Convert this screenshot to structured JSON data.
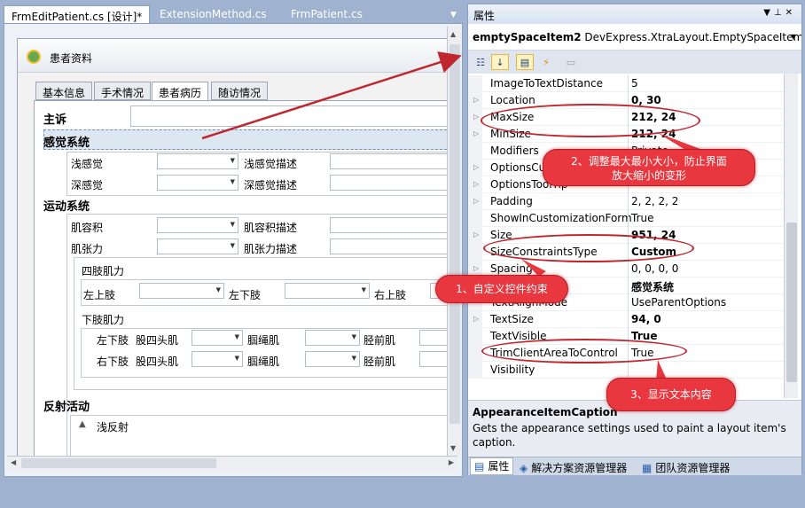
{
  "doc_tabs": [
    {
      "label": "FrmEditPatient.cs [设计]*",
      "active": true
    },
    {
      "label": "ExtensionMethod.cs",
      "active": false
    },
    {
      "label": "FrmPatient.cs",
      "active": false
    }
  ],
  "form": {
    "title": "患者资料",
    "tabs": [
      "基本信息",
      "手术情况",
      "患者病历",
      "随访情况"
    ],
    "active_tab": "患者病历",
    "chief_complaint": "主诉",
    "sensory": {
      "title": "感觉系统",
      "shallow": "浅感觉",
      "shallow_desc": "浅感觉描述",
      "deep": "深感觉",
      "deep_desc": "深感觉描述"
    },
    "motor": {
      "title": "运动系统",
      "volume": "肌容积",
      "volume_desc": "肌容积描述",
      "tension": "肌张力",
      "tension_desc": "肌张力描述",
      "limb_strength": "四肢肌力",
      "upper_left": "左上肢",
      "lower_left": "左下肢",
      "upper_right": "右上肢",
      "lower_strength": "下肢肌力",
      "left_lower": "左下肢",
      "right_lower": "右下肢",
      "quadriceps": "股四头肌",
      "hamstring": "腘绳肌",
      "tibialis": "胫前肌"
    },
    "reflex": {
      "title": "反射活动",
      "shallow": "浅反射"
    }
  },
  "properties": {
    "title": "属性",
    "object_name": "emptySpaceItem2",
    "object_type": "DevExpress.XtraLayout.EmptySpaceItem",
    "toolbar": [
      "categorized",
      "alphabetical",
      "properties",
      "events",
      "property-pages"
    ],
    "rows": [
      {
        "name": "ImageToTextDistance",
        "value": "5",
        "expandable": false,
        "bold": false
      },
      {
        "name": "Location",
        "value": "0, 30",
        "expandable": true,
        "bold": true
      },
      {
        "name": "MaxSize",
        "value": "212, 24",
        "expandable": true,
        "bold": true
      },
      {
        "name": "MinSize",
        "value": "212, 24",
        "expandable": true,
        "bold": true
      },
      {
        "name": "Modifiers",
        "value": "Private",
        "expandable": false,
        "bold": false
      },
      {
        "name": "OptionsCustomization",
        "value": "",
        "expandable": true,
        "bold": false
      },
      {
        "name": "OptionsToolTip",
        "value": "",
        "expandable": true,
        "bold": false
      },
      {
        "name": "Padding",
        "value": "2, 2, 2, 2",
        "expandable": true,
        "bold": false
      },
      {
        "name": "ShowInCustomizationForm",
        "value": "True",
        "expandable": false,
        "bold": false
      },
      {
        "name": "Size",
        "value": "951, 24",
        "expandable": true,
        "bold": true
      },
      {
        "name": "SizeConstraintsType",
        "value": "Custom",
        "expandable": false,
        "bold": true
      },
      {
        "name": "Spacing",
        "value": "0, 0, 0, 0",
        "expandable": true,
        "bold": false
      },
      {
        "name": "Text",
        "value": "感觉系统",
        "expandable": false,
        "bold": true
      },
      {
        "name": "TextAlignMode",
        "value": "UseParentOptions",
        "expandable": false,
        "bold": false
      },
      {
        "name": "TextSize",
        "value": "94, 0",
        "expandable": true,
        "bold": true
      },
      {
        "name": "TextVisible",
        "value": "True",
        "expandable": false,
        "bold": true
      },
      {
        "name": "TrimClientAreaToControl",
        "value": "True",
        "expandable": false,
        "bold": false
      },
      {
        "name": "Visibility",
        "value": "",
        "expandable": false,
        "bold": false
      }
    ],
    "description_title": "AppearanceItemCaption",
    "description_text": "Gets the appearance settings used to paint a layout item's caption.",
    "bottom_tabs": [
      "属性",
      "解决方案资源管理器",
      "团队资源管理器"
    ]
  },
  "callouts": {
    "one": "1、自定义控件约束",
    "two_line1": "2、调整最大最小大小，防止界面",
    "two_line2": "放大缩小的变形",
    "three": "3、显示文本内容"
  },
  "colors": {
    "callout": "#e8373f",
    "arrow": "#c0262d",
    "selection": "#dde7f2"
  }
}
